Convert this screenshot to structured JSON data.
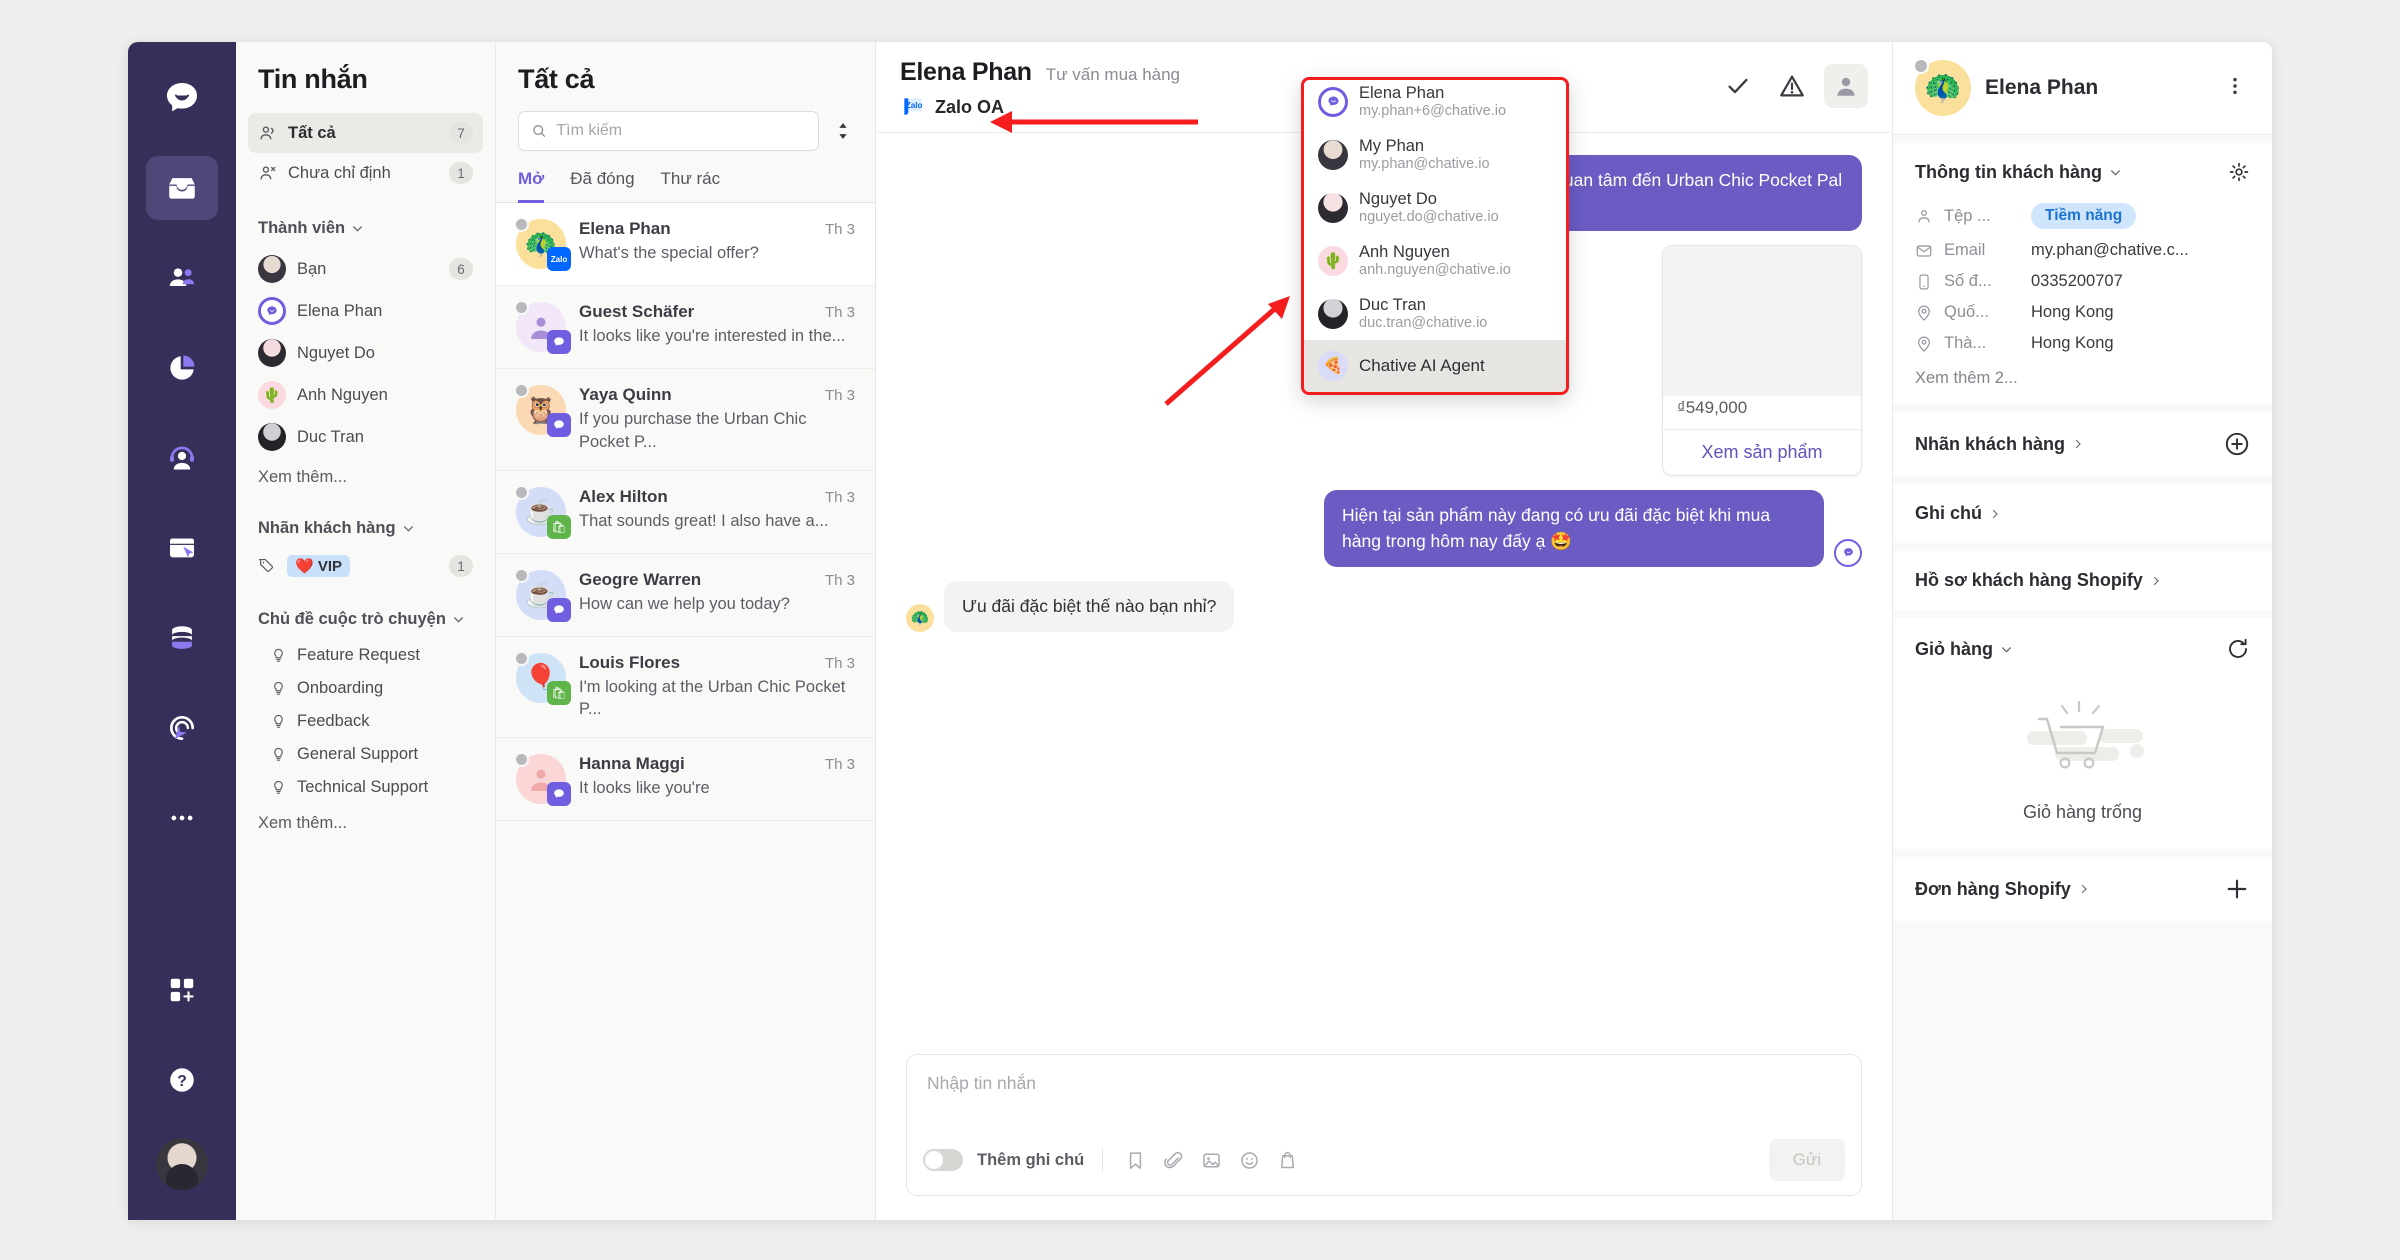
{
  "nav_rail": {
    "items": [
      {
        "name": "chat-logo-icon",
        "label": "Chative"
      },
      {
        "name": "inbox-icon",
        "label": "Hộp thư",
        "active": true
      },
      {
        "name": "contacts-icon",
        "label": "Liên hệ"
      },
      {
        "name": "reports-icon",
        "label": "Báo cáo"
      },
      {
        "name": "agents-icon",
        "label": "Nhân viên"
      },
      {
        "name": "widget-icon",
        "label": "Widget"
      },
      {
        "name": "data-icon",
        "label": "Dữ liệu"
      },
      {
        "name": "automation-icon",
        "label": "Tự động hoá"
      },
      {
        "name": "more-icon",
        "label": "Thêm"
      },
      {
        "name": "apps-icon",
        "label": "Ứng dụng"
      },
      {
        "name": "help-icon",
        "label": "Trợ giúp"
      }
    ]
  },
  "folders": {
    "title": "Tin nhắn",
    "items": [
      {
        "label": "Tất cả",
        "count": "7",
        "icon": "users-icon",
        "selected": true
      },
      {
        "label": "Chưa chỉ định",
        "count": "1",
        "icon": "user-unassigned-icon",
        "selected": false
      }
    ],
    "members_section": {
      "title": "Thành viên",
      "items": [
        {
          "label": "Bạn",
          "count": "6",
          "emoji": "",
          "color": "#e7dad0"
        },
        {
          "label": "Elena Phan",
          "count": "",
          "emoji": "",
          "color": "#6f5ee0"
        },
        {
          "label": "Nguyet Do",
          "count": "",
          "emoji": "",
          "color": "#f6dfe1"
        },
        {
          "label": "Anh Nguyen",
          "count": "",
          "emoji": "🌵",
          "color": "#fbd9e1"
        },
        {
          "label": "Duc Tran",
          "count": "",
          "emoji": "",
          "color": "#d9d9dd"
        }
      ],
      "more": "Xem thêm..."
    },
    "tags_section": {
      "title": "Nhãn khách hàng",
      "items": [
        {
          "label": "❤️ VIP",
          "count": "1"
        }
      ]
    },
    "topics_section": {
      "title": "Chủ đề cuộc trò chuyện",
      "items": [
        {
          "label": "Feature Request"
        },
        {
          "label": "Onboarding"
        },
        {
          "label": "Feedback"
        },
        {
          "label": "General Support"
        },
        {
          "label": "Technical Support"
        }
      ],
      "more": "Xem thêm..."
    }
  },
  "conversations": {
    "title": "Tất cả",
    "search_placeholder": "Tìm kiếm",
    "search_value": "",
    "sort_icon": "sort-icon",
    "tabs": [
      {
        "label": "Mở",
        "active": true
      },
      {
        "label": "Đã đóng",
        "active": false
      },
      {
        "label": "Thư rác",
        "active": false
      }
    ],
    "items": [
      {
        "name": "Elena Phan",
        "time": "Th 3",
        "preview": "What's the special offer?",
        "emoji": "🦚",
        "bg": "#fbe09b",
        "channel": "zalo",
        "selected": true
      },
      {
        "name": "Guest Schäfer",
        "time": "Th 3",
        "preview": "It looks like you're interested in the...",
        "emoji": "",
        "bg": "#f2e7f8",
        "channel": "chat",
        "selected": false
      },
      {
        "name": "Yaya Quinn",
        "time": "Th 3",
        "preview": "If you purchase the Urban Chic Pocket P...",
        "emoji": "🦉",
        "bg": "#fbd9b5",
        "channel": "chat",
        "selected": false
      },
      {
        "name": "Alex Hilton",
        "time": "Th 3",
        "preview": "That sounds great! I also have a...",
        "emoji": "☕",
        "bg": "#d4ddf8",
        "channel": "shopify",
        "selected": false
      },
      {
        "name": "Geogre Warren",
        "time": "Th 3",
        "preview": "How can we help you today?",
        "emoji": "☕",
        "bg": "#d4ddf8",
        "channel": "chat",
        "selected": false
      },
      {
        "name": "Louis Flores",
        "time": "Th 3",
        "preview": "I'm looking at the Urban Chic Pocket P...",
        "emoji": "🎈",
        "bg": "#cfe3f7",
        "channel": "shopify",
        "selected": false
      },
      {
        "name": "Hanna Maggi",
        "time": "Th 3",
        "preview": "It looks like you're",
        "emoji": "",
        "bg": "#fbd6d6",
        "channel": "chat",
        "selected": false
      }
    ]
  },
  "chat": {
    "title": "Elena Phan",
    "subtitle": "Tư vấn mua hàng",
    "channel_label": "Zalo OA",
    "channel_badge": "Zalo",
    "actions": [
      {
        "name": "resolve-check-icon",
        "label": "Đánh dấu đã xử lý"
      },
      {
        "name": "warning-icon",
        "label": "Cảnh báo"
      },
      {
        "name": "assignee-avatar-icon",
        "label": "Người phụ trách",
        "active": true
      }
    ],
    "messages": [
      {
        "side": "out",
        "text": "Có vẻ như mình đang quan tâm đến Urban Chic Pocket Pal của bên mình ạ?"
      },
      {
        "side": "out",
        "text": "Hiện tại sản phẩm này đang có ưu đãi đặc biệt khi mua hàng trong hôm nay đấy ạ 🤩",
        "avatar": "bot"
      },
      {
        "side": "in",
        "text": "Ưu đãi đặc biệt thế nào bạn nhỉ?",
        "avatar": "🦚"
      }
    ],
    "product_card": {
      "price": "₫549,000",
      "cta": "Xem sản phẩm"
    },
    "composer": {
      "placeholder": "Nhập tin nhắn",
      "value": "",
      "note_toggle_label": "Thêm ghi chú",
      "note_toggle_on": false,
      "tools": [
        {
          "name": "saved-reply-icon"
        },
        {
          "name": "attachment-icon"
        },
        {
          "name": "image-icon"
        },
        {
          "name": "emoji-icon"
        },
        {
          "name": "shopify-icon"
        }
      ],
      "send_label": "Gửi"
    }
  },
  "assignee_dropdown": {
    "items": [
      {
        "name": "Elena Phan",
        "email": "my.phan+6@chative.io",
        "emoji": "",
        "bg": "#6f5ee0",
        "highlighted": false
      },
      {
        "name": "My Phan",
        "email": "my.phan@chative.io",
        "emoji": "",
        "bg": "#3a3640",
        "highlighted": false
      },
      {
        "name": "Nguyet Do",
        "email": "nguyet.do@chative.io",
        "emoji": "",
        "bg": "#f4dde0",
        "highlighted": false
      },
      {
        "name": "Anh Nguyen",
        "email": "anh.nguyen@chative.io",
        "emoji": "🌵",
        "bg": "#fbd9e1",
        "highlighted": false
      },
      {
        "name": "Duc Tran",
        "email": "duc.tran@chative.io",
        "emoji": "",
        "bg": "#d9d9dd",
        "highlighted": false
      },
      {
        "name": "Chative AI Agent",
        "email": "",
        "emoji": "🍕",
        "bg": "#d9dcf8",
        "highlighted": true
      }
    ]
  },
  "right_panel": {
    "customer_name": "Elena Phan",
    "customer_emoji": "🦚",
    "menu_icon": "kebab-menu-icon",
    "info": {
      "title": "Thông tin khách hàng",
      "settings_icon": "gear-icon",
      "rows": [
        {
          "icon": "user-icon",
          "label": "Tệp ...",
          "value": "Tiềm năng",
          "is_pill": true
        },
        {
          "icon": "mail-icon",
          "label": "Email",
          "value": "my.phan@chative.c...",
          "is_pill": false
        },
        {
          "icon": "phone-icon",
          "label": "Số đ...",
          "value": "0335200707",
          "is_pill": false
        },
        {
          "icon": "location-icon",
          "label": "Quố...",
          "value": "Hong Kong",
          "is_pill": false
        },
        {
          "icon": "location-icon",
          "label": "Thà...",
          "value": "Hong Kong",
          "is_pill": false
        }
      ],
      "more": "Xem thêm 2..."
    },
    "sections": [
      {
        "title": "Nhãn khách hàng",
        "action_icon": "plus-circle-icon"
      },
      {
        "title": "Ghi chú",
        "action_icon": ""
      },
      {
        "title": "Hồ sơ khách hàng Shopify",
        "action_icon": ""
      }
    ],
    "cart": {
      "title": "Giỏ hàng",
      "refresh_icon": "refresh-icon",
      "empty_label": "Giỏ hàng trống"
    },
    "orders": {
      "title": "Đơn hàng Shopify",
      "action_icon": "plus-icon"
    }
  },
  "colors": {
    "rail_bg": "#35305a",
    "accent": "#6f5ee0",
    "bubble_out": "#6b5cc4",
    "annotation_red": "#f51d1d"
  }
}
